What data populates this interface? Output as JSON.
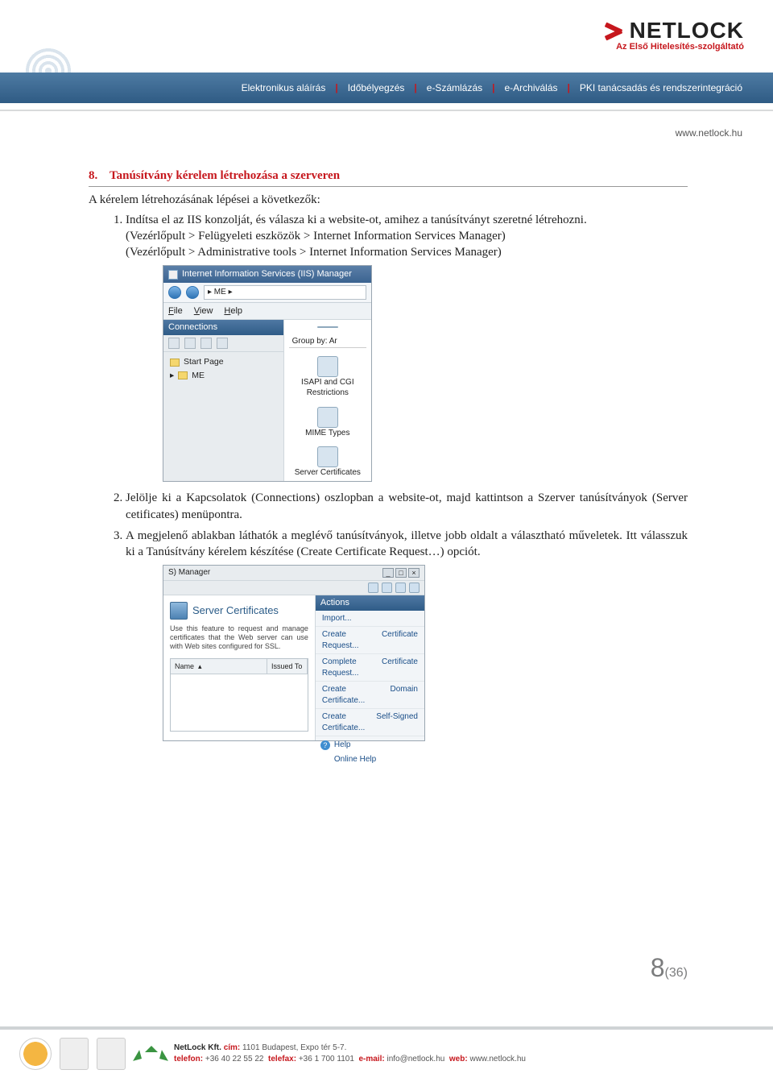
{
  "header": {
    "logo_text": "NETLOCK",
    "logo_sub": "Az Első Hitelesítés-szolgáltató",
    "nav": [
      "Elektronikus aláírás",
      "Időbélyegzés",
      "e-Számlázás",
      "e-Archiválás",
      "PKI tanácsadás és rendszerintegráció"
    ],
    "url": "www.netlock.hu"
  },
  "section": {
    "number": "8.",
    "title": "Tanúsítvány kérelem létrehozása a szerveren",
    "intro": "A kérelem létrehozásának lépései a következők:",
    "steps": [
      {
        "n": "1.",
        "text": "Indítsa el az IIS konzolját, és válasza ki a website-ot, amihez a tanúsítványt szeretné létrehozni.",
        "path1": "(Vezérlőpult > Felügyeleti eszközök > Internet Information Services Manager)",
        "path2": "(Vezérlőpult > Administrative tools > Internet Information Services Manager)"
      },
      {
        "n": "2.",
        "text": "Jelölje ki a Kapcsolatok (Connections) oszlopban a website-ot, majd kattintson a Szerver tanúsítványok (Server cetificates) menüpontra."
      },
      {
        "n": "3.",
        "text": "A megjelenő ablakban láthatók a meglévő tanúsítványok, illetve jobb oldalt a választható műveletek. Itt válasszuk ki a Tanúsítvány kérelem készítése (Create Certificate Request…) opciót."
      }
    ]
  },
  "shot1": {
    "title": "Internet Information Services (IIS) Manager",
    "breadcrumb": "▸ ME ▸",
    "menus": [
      "File",
      "View",
      "Help"
    ],
    "connections_label": "Connections",
    "tree": [
      "Start Page",
      "ME"
    ],
    "groupby": "Group by: Ar",
    "right_items": [
      {
        "label": "ISAPI and CGI Restrictions"
      },
      {
        "label": "MIME Types"
      },
      {
        "label": "Server Certificates"
      }
    ]
  },
  "shot2": {
    "titlebar_frag": "S) Manager",
    "panel_title": "Server Certificates",
    "desc": "Use this feature to request and manage certificates that the Web server can use with Web sites configured for SSL.",
    "col1": "Name",
    "col2": "Issued To",
    "actions_header": "Actions",
    "actions": [
      "Import...",
      "Create Certificate Request...",
      "Complete Certificate Request...",
      "Create Domain Certificate...",
      "Create Self-Signed Certificate..."
    ],
    "help": "Help",
    "online_help": "Online Help"
  },
  "page": {
    "num": "8",
    "of": "(36)"
  },
  "footer": {
    "company": "NetLock Kft.",
    "addr_label": "cím:",
    "addr": "1101 Budapest, Expo tér 5-7.",
    "tel_label": "telefon:",
    "tel": "+36 40 22 55 22",
    "fax_label": "telefax:",
    "fax": "+36 1 700 1101",
    "email_label": "e-mail:",
    "email": "info@netlock.hu",
    "web_label": "web:",
    "web": "www.netlock.hu"
  }
}
